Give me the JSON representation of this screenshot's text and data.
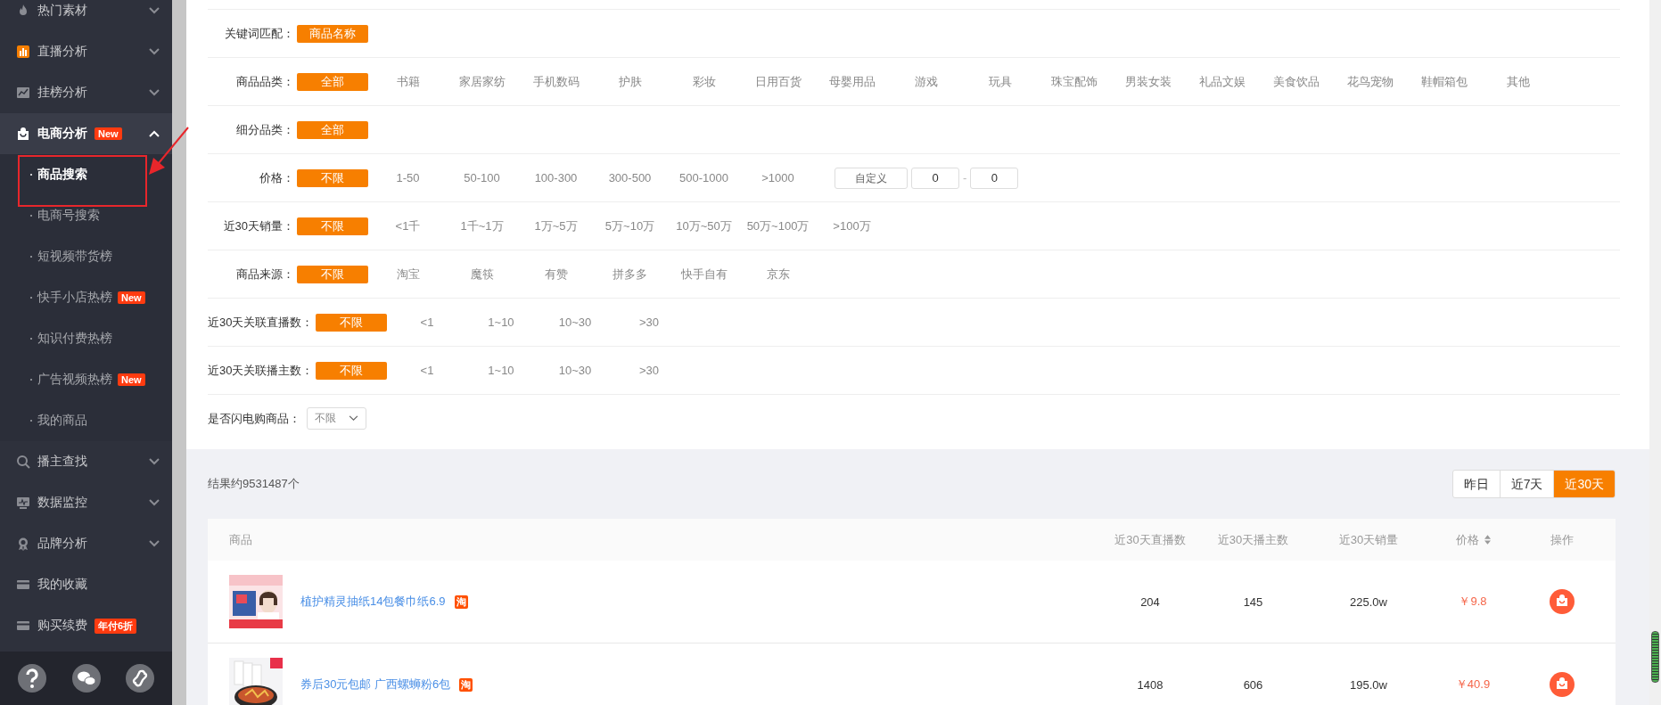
{
  "sidebar": {
    "items": [
      {
        "label": "热门素材",
        "kind": "menu",
        "expanded": false
      },
      {
        "label": "直播分析",
        "kind": "menu",
        "expanded": false
      },
      {
        "label": "挂榜分析",
        "kind": "menu",
        "expanded": false
      },
      {
        "label": "电商分析",
        "kind": "menu",
        "expanded": true,
        "badge": "New",
        "children": [
          {
            "label": "商品搜索",
            "selected": true
          },
          {
            "label": "电商号搜索",
            "selected": false
          },
          {
            "label": "短视频带货榜",
            "selected": false
          },
          {
            "label": "快手小店热榜",
            "selected": false,
            "badge": "New"
          },
          {
            "label": "知识付费热榜",
            "selected": false
          },
          {
            "label": "广告视频热榜",
            "selected": false,
            "badge": "New"
          },
          {
            "label": "我的商品",
            "selected": false
          }
        ]
      },
      {
        "label": "播主查找",
        "kind": "menu",
        "expanded": false
      },
      {
        "label": "数据监控",
        "kind": "menu",
        "expanded": false
      },
      {
        "label": "品牌分析",
        "kind": "menu",
        "expanded": false
      },
      {
        "label": "我的收藏",
        "kind": "link"
      },
      {
        "label": "购买续费",
        "kind": "link",
        "badge": "年付6折"
      }
    ]
  },
  "filters": [
    {
      "label": "关键词匹配：",
      "kind": "chips",
      "options": [
        {
          "label": "商品名称",
          "selected": true
        }
      ]
    },
    {
      "label": "商品品类：",
      "kind": "chips",
      "options": [
        {
          "label": "全部",
          "selected": true
        },
        {
          "label": "书籍",
          "selected": false
        },
        {
          "label": "家居家纺",
          "selected": false
        },
        {
          "label": "手机数码",
          "selected": false
        },
        {
          "label": "护肤",
          "selected": false
        },
        {
          "label": "彩妆",
          "selected": false
        },
        {
          "label": "日用百货",
          "selected": false
        },
        {
          "label": "母婴用品",
          "selected": false
        },
        {
          "label": "游戏",
          "selected": false
        },
        {
          "label": "玩具",
          "selected": false
        },
        {
          "label": "珠宝配饰",
          "selected": false
        },
        {
          "label": "男装女装",
          "selected": false
        },
        {
          "label": "礼品文娱",
          "selected": false
        },
        {
          "label": "美食饮品",
          "selected": false
        },
        {
          "label": "花鸟宠物",
          "selected": false
        },
        {
          "label": "鞋帽箱包",
          "selected": false
        },
        {
          "label": "其他",
          "selected": false
        }
      ]
    },
    {
      "label": "细分品类：",
      "kind": "chips",
      "options": [
        {
          "label": "全部",
          "selected": true
        }
      ]
    },
    {
      "label": "价格：",
      "kind": "chips",
      "options": [
        {
          "label": "不限",
          "selected": true
        },
        {
          "label": "1-50",
          "selected": false
        },
        {
          "label": "50-100",
          "selected": false
        },
        {
          "label": "100-300",
          "selected": false
        },
        {
          "label": "300-500",
          "selected": false
        },
        {
          "label": "500-1000",
          "selected": false
        },
        {
          "label": ">1000",
          "selected": false
        }
      ],
      "custom": {
        "button": "自定义",
        "min": "0",
        "separator": "-",
        "max": "0"
      }
    },
    {
      "label": "近30天销量：",
      "kind": "chips",
      "options": [
        {
          "label": "不限",
          "selected": true
        },
        {
          "label": "<1千",
          "selected": false
        },
        {
          "label": "1千~1万",
          "selected": false
        },
        {
          "label": "1万~5万",
          "selected": false
        },
        {
          "label": "5万~10万",
          "selected": false
        },
        {
          "label": "10万~50万",
          "selected": false
        },
        {
          "label": "50万~100万",
          "selected": false
        },
        {
          "label": ">100万",
          "selected": false
        }
      ]
    },
    {
      "label": "商品来源：",
      "kind": "chips",
      "options": [
        {
          "label": "不限",
          "selected": true
        },
        {
          "label": "淘宝",
          "selected": false
        },
        {
          "label": "魔筷",
          "selected": false
        },
        {
          "label": "有赞",
          "selected": false
        },
        {
          "label": "拼多多",
          "selected": false
        },
        {
          "label": "快手自有",
          "selected": false
        },
        {
          "label": "京东",
          "selected": false
        }
      ]
    },
    {
      "label": "近30天关联直播数：",
      "kind": "chips",
      "options": [
        {
          "label": "不限",
          "selected": true
        },
        {
          "label": "<1",
          "selected": false
        },
        {
          "label": "1~10",
          "selected": false
        },
        {
          "label": "10~30",
          "selected": false
        },
        {
          "label": ">30",
          "selected": false
        }
      ]
    },
    {
      "label": "近30天关联播主数：",
      "kind": "chips",
      "options": [
        {
          "label": "不限",
          "selected": true
        },
        {
          "label": "<1",
          "selected": false
        },
        {
          "label": "1~10",
          "selected": false
        },
        {
          "label": "10~30",
          "selected": false
        },
        {
          "label": ">30",
          "selected": false
        }
      ]
    },
    {
      "label": "是否闪电购商品：",
      "kind": "select",
      "value": "不限"
    }
  ],
  "results": {
    "summary": "结果约9531487个",
    "periods": [
      {
        "label": "昨日",
        "selected": false
      },
      {
        "label": "近7天",
        "selected": false
      },
      {
        "label": "近30天",
        "selected": true
      }
    ],
    "table": {
      "columns": [
        {
          "label": "商品",
          "sortable": false
        },
        {
          "label": "近30天直播数",
          "sortable": false
        },
        {
          "label": "近30天播主数",
          "sortable": false
        },
        {
          "label": "近30天销量",
          "sortable": false
        },
        {
          "label": "价格",
          "sortable": true
        },
        {
          "label": "操作",
          "sortable": false
        }
      ],
      "rows": [
        {
          "title": "植护精灵抽纸14包餐巾纸6.9",
          "source": "淘",
          "live_count": "204",
          "streamer_count": "145",
          "sales": "225.0w",
          "price": "￥9.8"
        },
        {
          "title": "券后30元包邮 广西螺蛳粉6包",
          "source": "淘",
          "live_count": "1408",
          "streamer_count": "606",
          "sales": "195.0w",
          "price": "￥40.9"
        }
      ]
    }
  }
}
